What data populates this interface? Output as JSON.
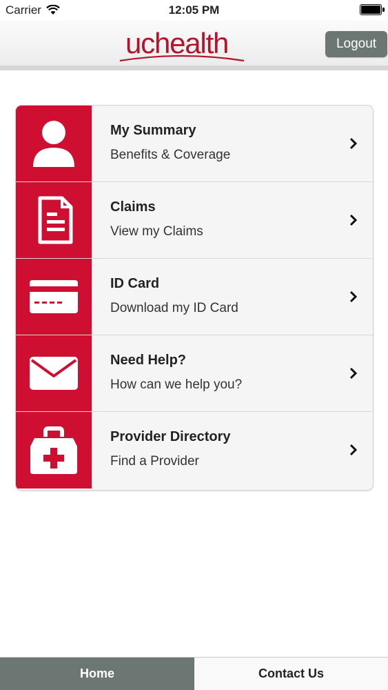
{
  "status_bar": {
    "carrier": "Carrier",
    "time": "12:05 PM",
    "icons": [
      "wifi-icon",
      "battery-icon"
    ]
  },
  "header": {
    "logo_text": "uchealth",
    "logout_label": "Logout"
  },
  "menu": {
    "items": [
      {
        "icon": "person-icon",
        "title": "My Summary",
        "subtitle": "Benefits & Coverage"
      },
      {
        "icon": "document-icon",
        "title": "Claims",
        "subtitle": "View my Claims"
      },
      {
        "icon": "id-card-icon",
        "title": "ID Card",
        "subtitle": "Download my ID Card"
      },
      {
        "icon": "envelope-icon",
        "title": "Need Help?",
        "subtitle": "How can we help you?"
      },
      {
        "icon": "medical-kit-icon",
        "title": "Provider Directory",
        "subtitle": "Find a Provider"
      }
    ]
  },
  "tabs": {
    "home": "Home",
    "contact": "Contact Us",
    "selected": "home"
  },
  "colors": {
    "brand_red": "#ce0f32",
    "logo_red": "#b3142b",
    "button_gray": "#6c7774",
    "card_background": "#f5f5f5"
  }
}
